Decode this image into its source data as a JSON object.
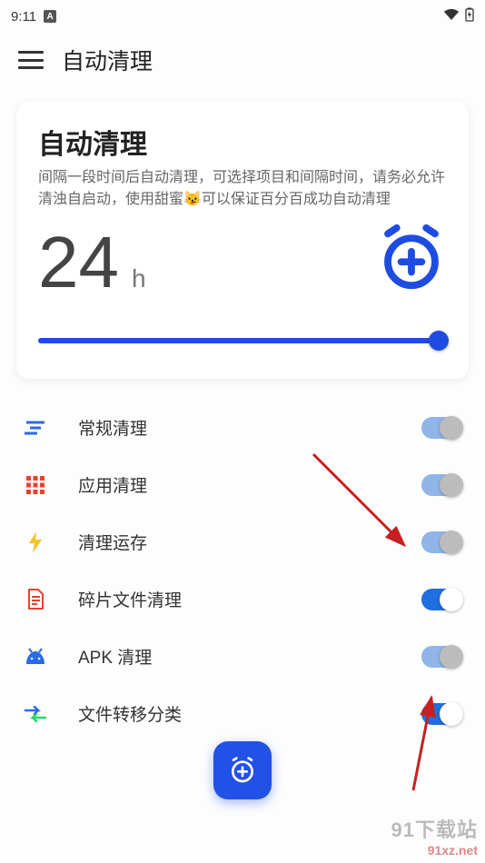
{
  "statusBar": {
    "time": "9:11",
    "badge": "A"
  },
  "appBar": {
    "title": "自动清理"
  },
  "card": {
    "title": "自动清理",
    "description": "间隔一段时间后自动清理，可选择项目和间隔时间，请务必允许清浊自启动，使用甜蜜😼可以保证百分百成功自动清理",
    "intervalValue": "24",
    "intervalUnit": "h"
  },
  "items": [
    {
      "icon": "lines-icon",
      "label": "常规清理",
      "toggle": "dim"
    },
    {
      "icon": "grid-icon",
      "label": "应用清理",
      "toggle": "dim"
    },
    {
      "icon": "bolt-icon",
      "label": "清理运存",
      "toggle": "dim"
    },
    {
      "icon": "doc-icon",
      "label": "碎片文件清理",
      "toggle": "bright"
    },
    {
      "icon": "android-icon",
      "label": "APK 清理",
      "toggle": "dim"
    },
    {
      "icon": "transfer-icon",
      "label": "文件转移分类",
      "toggle": "bright"
    }
  ],
  "watermark": {
    "line1": "91下载站",
    "line2": "91xz.net"
  }
}
